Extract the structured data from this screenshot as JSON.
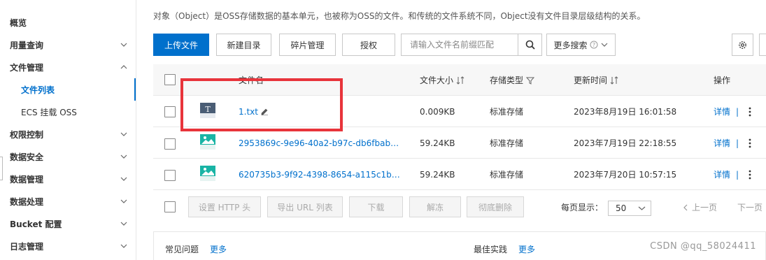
{
  "sidebar": {
    "items": [
      {
        "label": "概览",
        "chevron": "none"
      },
      {
        "label": "用量查询",
        "chevron": "down"
      },
      {
        "label": "文件管理",
        "chevron": "up"
      },
      {
        "label": "文件列表",
        "chevron": "none"
      },
      {
        "label": "ECS 挂载 OSS",
        "chevron": "none"
      },
      {
        "label": "权限控制",
        "chevron": "down"
      },
      {
        "label": "数据安全",
        "chevron": "down"
      },
      {
        "label": "数据管理",
        "chevron": "down"
      },
      {
        "label": "数据处理",
        "chevron": "down"
      },
      {
        "label": "Bucket 配置",
        "chevron": "down"
      },
      {
        "label": "日志管理",
        "chevron": "down"
      }
    ]
  },
  "description": "对象（Object）是OSS存储数据的基本单元，也被称为OSS的文件。和传统的文件系统不同，Object没有文件目录层级结构的关系。",
  "toolbar": {
    "upload": "上传文件",
    "new_dir": "新建目录",
    "fragments": "碎片管理",
    "authorize": "授权",
    "search_placeholder": "请输入文件名前缀匹配",
    "more_search": "更多搜索"
  },
  "table": {
    "headers": {
      "name": "文件名",
      "size": "文件大小",
      "storage": "存储类型",
      "updated": "更新时间",
      "actions": "操作"
    },
    "rows": [
      {
        "name": "1.txt",
        "icon": "text-file-icon",
        "size": "0.009KB",
        "storage": "标准存储",
        "updated": "2023年8月19日 16:01:58",
        "detail": "详情",
        "sep": "|"
      },
      {
        "name": "2953869c-9e96-40a2-b97c-db6fbab…",
        "icon": "image-file-icon",
        "size": "59.24KB",
        "storage": "标准存储",
        "updated": "2023年7月19日 22:18:55",
        "detail": "详情",
        "sep": "|"
      },
      {
        "name": "620735b3-9f92-4398-8654-a115c1b…",
        "icon": "image-file-icon",
        "size": "59.24KB",
        "storage": "标准存储",
        "updated": "2023年7月20日 10:57:15",
        "detail": "详情",
        "sep": "|"
      }
    ]
  },
  "bulk": {
    "set_http": "设置 HTTP 头",
    "export_url": "导出 URL 列表",
    "download": "下载",
    "unfreeze": "解冻",
    "delete": "彻底删除",
    "page_size_label": "每页显示：",
    "page_size": "50",
    "prev": "上一页",
    "next": "下一页"
  },
  "cards": {
    "faq": "常见问题",
    "faq_more": "更多",
    "best": "最佳实践",
    "best_more": "更多"
  },
  "watermark": "CSDN @qq_58024411",
  "colors": {
    "accent": "#0070cc",
    "highlight": "#e8343b"
  }
}
